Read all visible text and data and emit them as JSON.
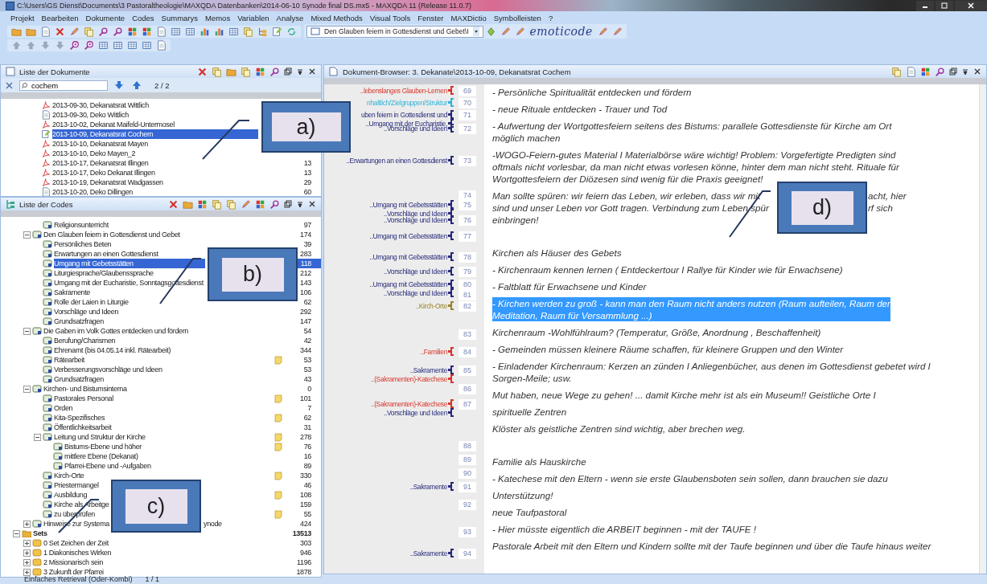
{
  "window": {
    "title": "C:\\Users\\GS Dienst\\Documents\\3 Pastoraltheologie\\MAXQDA Datenbanken\\2014-06-10 Synode final DS.mx5 - MAXQDA 11  (Release 11.0.7)"
  },
  "menu": [
    "Projekt",
    "Bearbeiten",
    "Dokumente",
    "Codes",
    "Summarys",
    "Memos",
    "Variablen",
    "Analyse",
    "Mixed Methods",
    "Visual Tools",
    "Fenster",
    "MAXDictio",
    "Symbolleisten",
    "?"
  ],
  "toolbar": {
    "code_selector": "Den Glauben feiern in Gottesdienst und Gebet\\I",
    "logo": "emoticode"
  },
  "documents": {
    "title": "Liste der Dokumente",
    "search": {
      "value": "cochem"
    },
    "match_count": "2 / 2",
    "items": [
      {
        "label": "2013-09-30, Dekanatsrat Wittlich",
        "kind": "pdf",
        "selected": false
      },
      {
        "label": "2013-09-30, Deko Wittlich",
        "kind": "text",
        "selected": false
      },
      {
        "label": "2013-10-02, Dekanat Maifeld-Untermosel",
        "kind": "pdf",
        "selected": false
      },
      {
        "label": "2013-10-09, Dekanatsrat Cochem",
        "kind": "edited",
        "selected": true
      },
      {
        "label": "2013-10-10, Dekanatsrat Mayen",
        "kind": "pdf",
        "selected": false
      },
      {
        "label": "2013-10-10, Deko Mayen_2",
        "kind": "pdf",
        "selected": false
      },
      {
        "label": "2013-10-17, Dekanatsrat Illingen",
        "kind": "pdf",
        "count": "13",
        "selected": false
      },
      {
        "label": "2013-10-17, Deko Dekanat Illingen",
        "kind": "pdf",
        "count": "13",
        "selected": false
      },
      {
        "label": "2013-10-19, Dekanatsrat Wadgassen",
        "kind": "pdf",
        "count": "29",
        "selected": false
      },
      {
        "label": "2013-10-20, Deko Dillingen",
        "kind": "text",
        "count": "60",
        "selected": false
      }
    ]
  },
  "codes": {
    "title": "Liste der Codes",
    "items": [
      {
        "children": [
          {
            "children": [
              {
                "label": "Religionsunterricht",
                "kind": "code",
                "count": "97",
                "memo": false,
                "selected": false
              }
            ]
          },
          {
            "label": "Den Glauben feiern in Gottesdienst und Gebet",
            "kind": "code",
            "count": "174",
            "memo": false,
            "selected": false,
            "expanded": true,
            "children": [
              {
                "label": "Persönliches Beten",
                "kind": "code",
                "count": "39",
                "memo": false,
                "selected": false
              },
              {
                "label": "Erwartungen an einen Gottesdienst",
                "kind": "code",
                "count": "283",
                "memo": false,
                "selected": false
              },
              {
                "label": "Umgang mit Gebetsstätten",
                "kind": "code",
                "count": "118",
                "memo": false,
                "selected": true
              },
              {
                "label": "Liturgiesprache/Glaubenssprache",
                "kind": "code",
                "count": "212",
                "memo": false,
                "selected": false
              },
              {
                "label": "Umgang mit der Eucharistie, Sonntagsgottesdienst",
                "kind": "code",
                "count": "143",
                "memo": false,
                "selected": false
              },
              {
                "label": "Sakramente",
                "kind": "code",
                "count": "106",
                "memo": false,
                "selected": false
              },
              {
                "label": "Rolle der Laien in Liturgie",
                "kind": "code",
                "count": "62",
                "memo": false,
                "selected": false
              },
              {
                "label": "Vorschläge und Ideen",
                "kind": "code",
                "count": "292",
                "memo": false,
                "selected": false
              },
              {
                "label": "Grundsatzfragen",
                "kind": "code",
                "count": "147",
                "memo": false,
                "selected": false
              }
            ]
          },
          {
            "label": "Die Gaben im Volk Gottes entdecken und fördern",
            "kind": "code",
            "count": "54",
            "memo": false,
            "selected": false,
            "expanded": true,
            "children": [
              {
                "label": "Berufung/Charismen",
                "kind": "code",
                "count": "42",
                "memo": false,
                "selected": false
              },
              {
                "label": "Ehrenamt (bis 04.05.14 inkl. Rätearbeit)",
                "kind": "code",
                "count": "344",
                "memo": false,
                "selected": false
              },
              {
                "label": "Rätearbeit",
                "kind": "code",
                "count": "53",
                "memo": true,
                "selected": false
              },
              {
                "label": "Verbesserungsvorschläge und Ideen",
                "kind": "code",
                "count": "53",
                "memo": false,
                "selected": false
              },
              {
                "label": "Grundsatzfragen",
                "kind": "code",
                "count": "43",
                "memo": false,
                "selected": false
              }
            ]
          },
          {
            "label": "Kirchen- und Bistumsinterna",
            "kind": "code",
            "count": "0",
            "memo": false,
            "selected": false,
            "expanded": true,
            "children": [
              {
                "label": "Pastorales Personal",
                "kind": "code",
                "count": "101",
                "memo": true,
                "selected": false
              },
              {
                "label": "Orden",
                "kind": "code",
                "count": "7",
                "memo": false,
                "selected": false
              },
              {
                "label": "Kita-Spezifisches",
                "kind": "code",
                "count": "62",
                "memo": true,
                "selected": false
              },
              {
                "label": "Öffentlichkeitsarbeit",
                "kind": "code",
                "count": "31",
                "memo": false,
                "selected": false
              },
              {
                "label": "Leitung und Struktur der Kirche",
                "kind": "code",
                "count": "278",
                "memo": true,
                "selected": false,
                "expanded": true,
                "children": [
                  {
                    "label": "Bistums-Ebene und höher",
                    "kind": "code",
                    "count": "76",
                    "memo": true,
                    "selected": false
                  },
                  {
                    "label": "mittlere Ebene (Dekanat)",
                    "kind": "code",
                    "count": "16",
                    "memo": false,
                    "selected": false
                  },
                  {
                    "label": "Pfarrei-Ebene und -Aufgaben",
                    "kind": "code",
                    "count": "89",
                    "memo": false,
                    "selected": false
                  }
                ]
              },
              {
                "label": "Kirch-Orte",
                "kind": "code",
                "count": "330",
                "memo": true,
                "selected": false
              },
              {
                "label": "Priestermangel",
                "kind": "code",
                "count": "46",
                "memo": false,
                "selected": false
              },
              {
                "label": "Ausbildung",
                "kind": "code",
                "count": "108",
                "memo": true,
                "selected": false
              },
              {
                "label": "Kirche als Arbeitge",
                "kind": "code",
                "count": "159",
                "memo": false,
                "selected": false
              },
              {
                "label": "zu überprüfen",
                "kind": "code",
                "count": "55",
                "memo": true,
                "selected": false
              }
            ]
          },
          {
            "label": [
              "Hinweise zur Systema",
              "ynode"
            ],
            "kind": "code",
            "count": "424",
            "memo": false,
            "selected": false,
            "expanded": false
          }
        ]
      },
      {
        "label": "Sets",
        "kind": "sets",
        "count": "13513",
        "memo": false,
        "selected": false,
        "expanded": true,
        "children": [
          {
            "label": "0 Set Zeichen der Zeit",
            "kind": "set",
            "count": "303",
            "memo": false,
            "selected": false,
            "expanded": false
          },
          {
            "label": "1 Diakonisches Wirken",
            "kind": "set",
            "count": "946",
            "memo": false,
            "selected": false,
            "expanded": false
          },
          {
            "label": "2 Missionarisch sein",
            "kind": "set",
            "count": "1196",
            "memo": false,
            "selected": false,
            "expanded": false
          },
          {
            "label": "3 Zukunft der Pfarrei",
            "kind": "set",
            "count": "1878",
            "memo": false,
            "selected": false,
            "expanded": false
          }
        ]
      }
    ]
  },
  "browser": {
    "title": "Dokument-Browser: 3. Dekanate\\2013-10-09, Dekanatsrat Cochem",
    "margin": [
      {
        "line": "69",
        "codes": [
          {
            "label": "..lebenslanges Glauben-Lernen",
            "color": "#d8352a"
          }
        ]
      },
      {
        "line": "70",
        "codes": [
          {
            "label": "nhaltlich/Zielgruppen/Struktur",
            "color": "#2fb4d8"
          }
        ]
      },
      {
        "line": "71",
        "codes": [
          {
            "label": "uben feiern in Gottesdienst und",
            "color": "#26297a"
          },
          {
            "label": "..Umgang mit der Eucharistie,",
            "color": "#26297a"
          }
        ]
      },
      {
        "line": "72",
        "codes": [
          {
            "label": "..Vorschläge und Ideen",
            "color": "#26297a"
          }
        ]
      },
      {
        "line": "73",
        "codes": [
          {
            "label": "..Erwartungen an einen Gottesdienst",
            "color": "#26297a"
          }
        ]
      },
      {
        "line": "74"
      },
      {
        "line": "75",
        "codes": [
          {
            "label": "..Umgang mit Gebetsstätten",
            "color": "#26297a"
          },
          {
            "label": "..Vorschläge und Ideen",
            "color": "#26297a"
          }
        ]
      },
      {
        "line": "76",
        "codes": [
          {
            "label": "..Vorschläge und Ideen",
            "color": "#26297a"
          }
        ]
      },
      {
        "line": "77",
        "codes": [
          {
            "label": "..Umgang mit Gebetsstätten",
            "color": "#26297a"
          }
        ]
      },
      {
        "line": "78",
        "codes": [
          {
            "label": "..Umgang mit Gebetsstätten",
            "color": "#26297a"
          }
        ]
      },
      {
        "line": "79",
        "codes": [
          {
            "label": "..Vorschläge und Ideen",
            "color": "#26297a"
          }
        ]
      },
      {
        "line": "80",
        "codes": [
          {
            "label": "..Umgang mit Gebetsstätten",
            "color": "#26297a"
          },
          {
            "label": "..Vorschläge und Ideen",
            "color": "#26297a"
          }
        ]
      },
      {
        "line": "81"
      },
      {
        "line": "82",
        "codes": [
          {
            "label": "..Kirch-Orte",
            "color": "#9a8428"
          }
        ]
      },
      {
        "line": "83"
      },
      {
        "line": "84",
        "codes": [
          {
            "label": "..Familien",
            "color": "#d8352a"
          }
        ]
      },
      {
        "line": "85",
        "codes": [
          {
            "label": "..Sakramente",
            "color": "#26297a"
          },
          {
            "label": "..(Sakramenten)-Katechese",
            "color": "#d8352a"
          }
        ]
      },
      {
        "line": "86"
      },
      {
        "line": "87",
        "codes": [
          {
            "label": "..(Sakramenten)-Katechese",
            "color": "#d8352a"
          },
          {
            "label": "..Vorschläge und Ideen",
            "color": "#26297a"
          }
        ]
      },
      {
        "line": "88"
      },
      {
        "line": "89"
      },
      {
        "line": "90"
      },
      {
        "line": "91",
        "codes": [
          {
            "label": "..Sakramente",
            "color": "#26297a"
          }
        ]
      },
      {
        "line": "92"
      },
      {
        "line": "93"
      },
      {
        "line": "94",
        "codes": [
          {
            "label": "..Sakramente",
            "color": "#26297a"
          }
        ]
      }
    ],
    "paragraphs": [
      {
        "kind": "text",
        "selected": false,
        "lines": [
          "- Persönliche Spiritualität entdecken und fördern"
        ]
      },
      {
        "kind": "text",
        "selected": false,
        "lines": [
          "- neue Rituale entdecken - Trauer und Tod"
        ]
      },
      {
        "kind": "text",
        "selected": false,
        "lines": [
          "- Aufwertung der Wortgottesfeiern seitens des Bistums: parallele Gottesdienste für Kirche am Ort",
          "möglich machen"
        ]
      },
      {
        "kind": "text",
        "selected": false,
        "lines": [
          "-WOGO-Feiern-gutes Material I Materialbörse wäre wichtig! Problem: Vorgefertigte Predigten sind",
          "oftmals nicht vorlesbar, da man nicht etwas vorlesen könne, hinter dem man nicht steht. Rituale für",
          "Wortgottesfeiern der Diözesen sind wenig für die Praxis geeignet!"
        ]
      },
      {
        "kind": "text",
        "selected": false,
        "lines": [
          [
            "Man sollte spüren: wir feiern das Leben, wir erleben, dass wir mit",
            "acht, hier"
          ],
          [
            "sind und unser Leben vor Gott tragen. Verbindung zum Leben spür",
            "rf sich"
          ],
          "einbringen!"
        ]
      },
      {
        "kind": "heading",
        "selected": false,
        "lines": [
          "Kirchen als Häuser des Gebets"
        ]
      },
      {
        "kind": "text",
        "selected": false,
        "lines": [
          "- Kirchenraum kennen lernen ( Entdeckertour I Rallye für Kinder wie für Erwachsene)"
        ]
      },
      {
        "kind": "text",
        "selected": false,
        "lines": [
          "- Faltblatt für Erwachsene und Kinder"
        ]
      },
      {
        "kind": "text",
        "selected": true,
        "lines": [
          "- Kirchen werden zu groß - kann man den Raum nicht anders nutzen (Raum aufteilen, Raum der",
          "Meditation, Raum für Versammlung ...)"
        ]
      },
      {
        "kind": "text",
        "selected": false,
        "lines": [
          "Kirchenraum -Wohlfühlraum? (Temperatur, Größe, Anordnung , Beschaffenheit)"
        ]
      },
      {
        "kind": "text",
        "selected": false,
        "lines": [
          "- Gemeinden müssen kleinere Räume schaffen, für kleinere Gruppen und den Winter"
        ]
      },
      {
        "kind": "text",
        "selected": false,
        "lines": [
          "- Einladender Kirchenraum: Kerzen an zünden I Anliegenbücher, aus denen im Gottesdienst gebetet wird I",
          "Sorgen-Meile; usw."
        ]
      },
      {
        "kind": "text",
        "selected": false,
        "lines": [
          "Mut haben, neue Wege zu gehen! ... damit Kirche mehr ist als ein Museum!! Geistliche Orte I"
        ]
      },
      {
        "kind": "text",
        "selected": false,
        "lines": [
          "spirituelle Zentren"
        ]
      },
      {
        "kind": "text",
        "selected": false,
        "lines": [
          "Klöster als geistliche Zentren sind wichtig, aber brechen weg."
        ]
      },
      {
        "kind": "heading",
        "selected": false,
        "lines": [
          "Familie als Hauskirche"
        ]
      },
      {
        "kind": "text",
        "selected": false,
        "lines": [
          "- Katechese mit den Eltern - wenn sie erste Glaubensboten sein sollen, dann brauchen sie dazu"
        ]
      },
      {
        "kind": "text",
        "selected": false,
        "lines": [
          "Unterstützung!"
        ]
      },
      {
        "kind": "text",
        "selected": false,
        "lines": [
          "neue Taufpastoral"
        ]
      },
      {
        "kind": "text",
        "selected": false,
        "lines": [
          "- Hier müsste eigentlich die ARBEIT beginnen - mit der TAUFE !"
        ]
      },
      {
        "kind": "text",
        "selected": false,
        "lines": [
          "Pastorale Arbeit mit den Eltern und Kindern sollte mit der Taufe beginnen und über die Taufe hinaus weiter"
        ]
      }
    ]
  },
  "status_bar": {
    "retrieval": "Einfaches Retrieval (Oder-Kombi)",
    "page": "1 / 1"
  },
  "callouts": [
    {
      "label": "a)"
    },
    {
      "label": "b)"
    },
    {
      "label": "c)"
    },
    {
      "label": "d)"
    }
  ]
}
